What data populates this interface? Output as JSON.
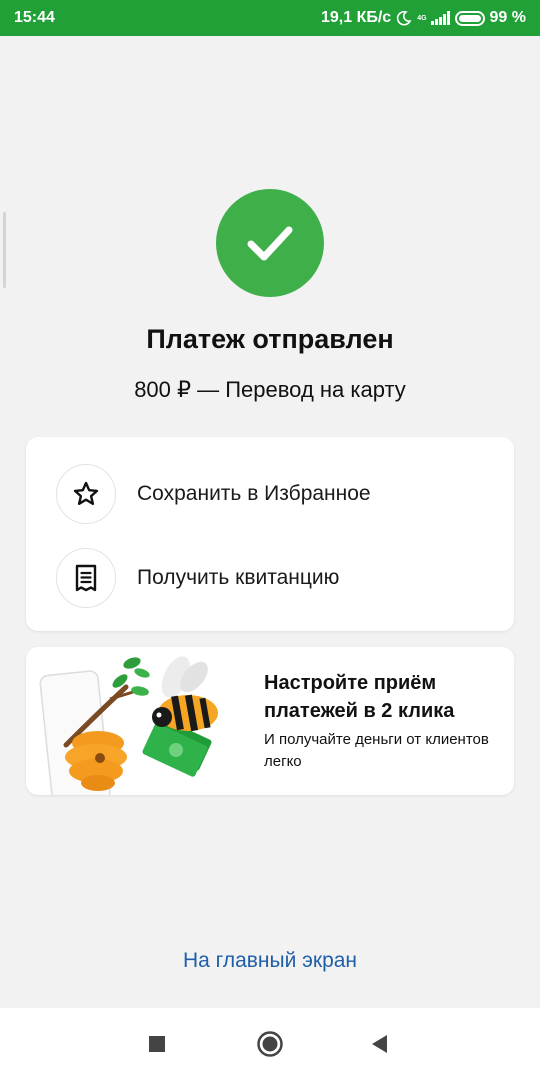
{
  "status_bar": {
    "time": "15:44",
    "speed": "19,1 КБ/с",
    "network": "4G",
    "battery": "99 %"
  },
  "result": {
    "title": "Платеж отправлен",
    "subtitle": "800 ₽ — Перевод на карту",
    "accent_color": "#3fb049"
  },
  "actions": [
    {
      "label": "Сохранить в Избранное",
      "icon": "star-icon"
    },
    {
      "label": "Получить квитанцию",
      "icon": "receipt-icon"
    }
  ],
  "promo": {
    "title": "Настройте приём платежей в 2 клика",
    "text": "И получайте деньги от клиентов легко"
  },
  "footer": {
    "home_link": "На главный экран",
    "link_color": "#1f5fa8"
  },
  "nav": {
    "buttons": [
      "recents-icon",
      "home-icon",
      "back-icon"
    ]
  }
}
